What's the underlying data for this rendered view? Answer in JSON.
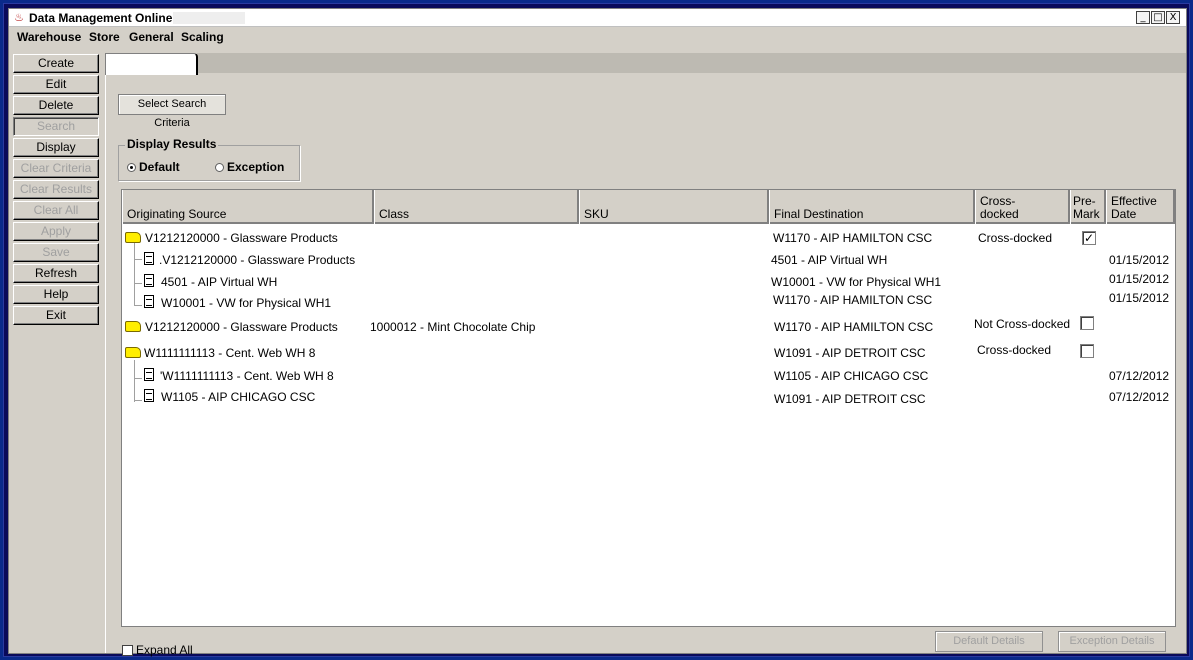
{
  "window": {
    "title": "Data Management Online -",
    "controls": [
      "_",
      "□",
      "X"
    ]
  },
  "menu": [
    "Warehouse",
    "Store",
    "General",
    "Scaling"
  ],
  "sidebar": [
    {
      "label": "Create",
      "enabled": true
    },
    {
      "label": "Edit",
      "enabled": true
    },
    {
      "label": "Delete",
      "enabled": true
    },
    {
      "label": "Search",
      "enabled": false
    },
    {
      "label": "Display",
      "enabled": true
    },
    {
      "label": "Clear Criteria",
      "enabled": false
    },
    {
      "label": "Clear Results",
      "enabled": false
    },
    {
      "label": "Clear All",
      "enabled": false
    },
    {
      "label": "Apply",
      "enabled": false
    },
    {
      "label": "Save",
      "enabled": false
    },
    {
      "label": "Refresh",
      "enabled": true
    },
    {
      "label": "Help",
      "enabled": true
    },
    {
      "label": "Exit",
      "enabled": true
    }
  ],
  "select_criteria_label": "Select Search Criteria",
  "display_results": {
    "legend": "Display Results",
    "options": [
      "Default",
      "Exception"
    ],
    "selected": "Default"
  },
  "grid": {
    "columns": [
      "Originating Source",
      "Class",
      "SKU",
      "Final Destination",
      "Cross-\ndocked",
      "Pre-\nMark",
      "Effective\nDate"
    ],
    "rows": [
      {
        "type": "folder",
        "source": "V1212120000 - Glassware Products",
        "class": "",
        "sku": "",
        "dest": "W1170 - AIP HAMILTON CSC",
        "cross": "Cross-docked",
        "premark": "checked",
        "date": ""
      },
      {
        "type": "doc",
        "source": ".V1212120000 - Glassware Products",
        "class": "",
        "sku": "",
        "dest": "4501 - AIP Virtual WH",
        "cross": "",
        "premark": "",
        "date": "01/15/2012"
      },
      {
        "type": "doc",
        "source": "4501 - AIP Virtual WH",
        "class": "",
        "sku": "",
        "dest": "W10001 - VW for Physical WH1",
        "cross": "",
        "premark": "",
        "date": "01/15/2012"
      },
      {
        "type": "doc",
        "source": "W10001 - VW for Physical WH1",
        "class": "",
        "sku": "",
        "dest": "W1170 - AIP HAMILTON CSC",
        "cross": "",
        "premark": "",
        "date": "01/15/2012"
      },
      {
        "type": "folder",
        "source": "V1212120000 - Glassware Products",
        "class": "1000012 - Mint Chocolate Chip",
        "sku": "",
        "dest": "W1170 - AIP HAMILTON CSC",
        "cross": "Not Cross-docked",
        "premark": "unchecked",
        "date": ""
      },
      {
        "type": "folder",
        "source": "W1111111113 - Cent. Web WH 8",
        "class": "",
        "sku": "",
        "dest": "W1091 - AIP DETROIT CSC",
        "cross": "Cross-docked",
        "premark": "unchecked",
        "date": ""
      },
      {
        "type": "doc",
        "source": "'W1111111113 - Cent. Web WH 8",
        "class": "",
        "sku": "",
        "dest": "W1105 - AIP CHICAGO CSC",
        "cross": "",
        "premark": "",
        "date": "07/12/2012"
      },
      {
        "type": "doc",
        "source": "W1105 - AIP CHICAGO CSC",
        "class": "",
        "sku": "",
        "dest": "W1091 - AIP DETROIT CSC",
        "cross": "",
        "premark": "",
        "date": "07/12/2012"
      }
    ]
  },
  "expand_all_label": "Expand All",
  "buttons": {
    "default_details": "Default Details",
    "exception_details": "Exception Details"
  }
}
